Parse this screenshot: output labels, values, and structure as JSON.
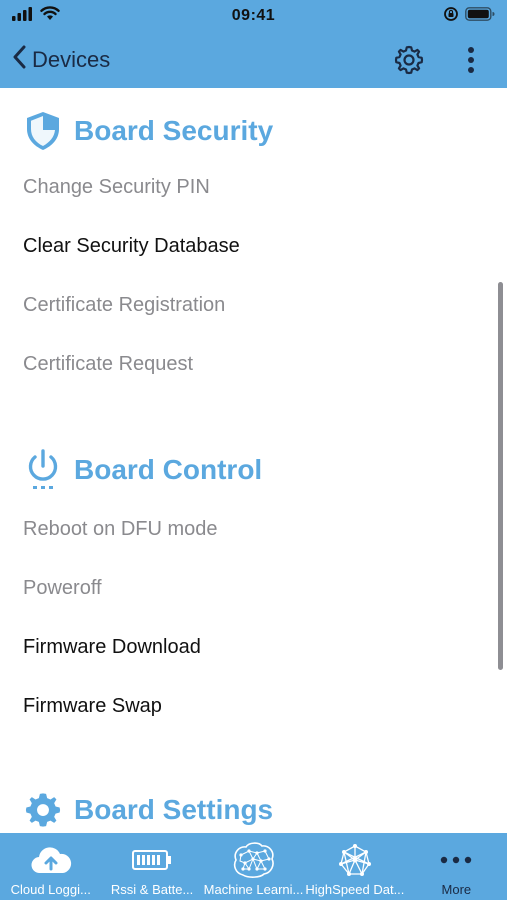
{
  "status_bar": {
    "time": "09:41",
    "signal_icon": "signal-bars-icon",
    "wifi_icon": "wifi-icon",
    "lock_icon": "orientation-lock-icon",
    "battery_icon": "battery-icon"
  },
  "navbar": {
    "back_label": "Devices",
    "settings_icon": "gear-icon",
    "more_icon": "vertical-ellipsis-icon"
  },
  "sections": {
    "security": {
      "title": "Board Security",
      "icon": "shield-icon",
      "items": [
        {
          "label": "Change Security PIN",
          "enabled": false
        },
        {
          "label": "Clear Security Database",
          "enabled": true
        },
        {
          "label": "Certificate Registration",
          "enabled": false
        },
        {
          "label": "Certificate Request",
          "enabled": false
        }
      ]
    },
    "control": {
      "title": "Board Control",
      "icon": "power-icon",
      "items": [
        {
          "label": "Reboot on DFU mode",
          "enabled": false
        },
        {
          "label": "Poweroff",
          "enabled": false
        },
        {
          "label": "Firmware Download",
          "enabled": true
        },
        {
          "label": "Firmware Swap",
          "enabled": true
        }
      ]
    },
    "settings": {
      "title": "Board Settings",
      "icon": "gear-icon"
    }
  },
  "tabs": [
    {
      "label": "Cloud Loggi...",
      "icon": "cloud-upload-icon"
    },
    {
      "label": "Rssi & Batte...",
      "icon": "battery-icon"
    },
    {
      "label": "Machine Learni...",
      "icon": "brain-icon"
    },
    {
      "label": "HighSpeed Dat...",
      "icon": "network-icon"
    },
    {
      "label": "More",
      "icon": "more-dots-icon"
    }
  ],
  "colors": {
    "accent": "#5ba8df",
    "disabled_text": "#8a8a8e",
    "enabled_text": "#111111",
    "active_tab": "#1a2a44"
  }
}
